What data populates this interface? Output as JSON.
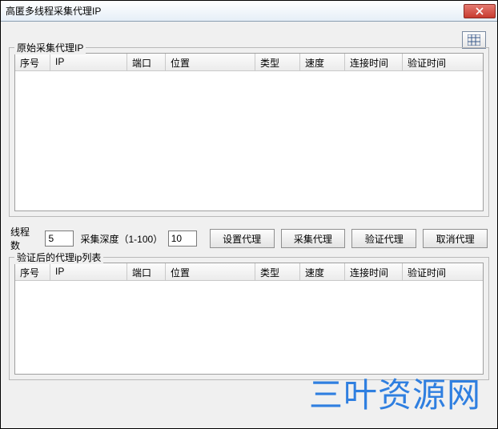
{
  "window": {
    "title": "高匿多线程采集代理IP"
  },
  "group1": {
    "legend": "原始采集代理IP"
  },
  "group2": {
    "legend": "验证后的代理ip列表"
  },
  "columns": {
    "seq": "序号",
    "ip": "IP",
    "port": "端口",
    "loc": "位置",
    "type": "类型",
    "speed": "速度",
    "conn": "连接时间",
    "ver": "验证时间"
  },
  "controls": {
    "threads_label": "线程数",
    "threads_value": "5",
    "depth_label": "采集深度（1-100）",
    "depth_value": "10"
  },
  "buttons": {
    "set": "设置代理",
    "collect": "采集代理",
    "verify": "验证代理",
    "cancel": "取消代理"
  },
  "watermark": "三叶资源网"
}
